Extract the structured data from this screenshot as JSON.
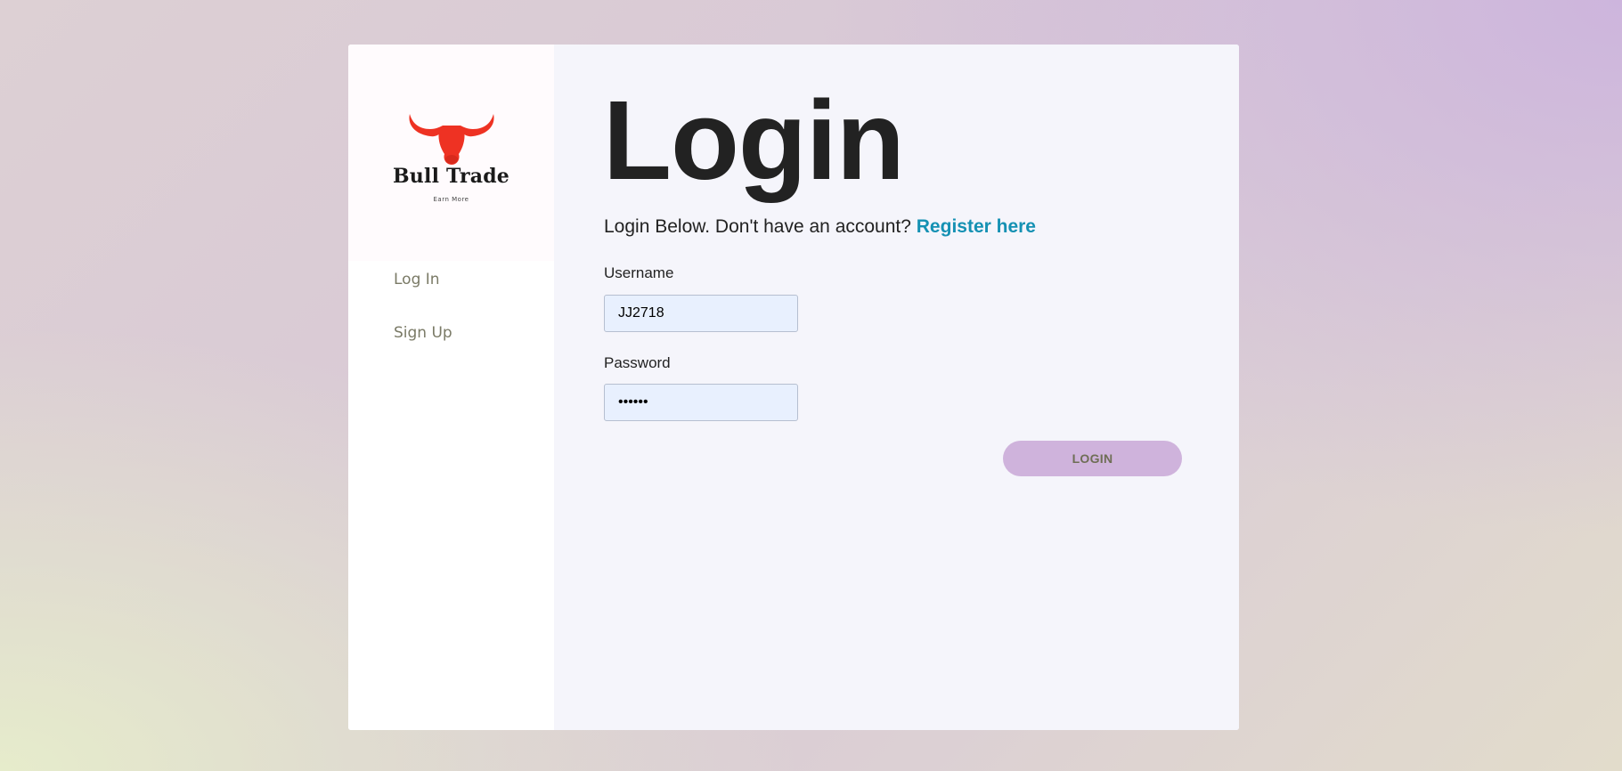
{
  "brand": {
    "name": "Bull Trade",
    "tagline": "Earn More",
    "logo_icon": "bull-head-icon",
    "logo_color": "#ee3223"
  },
  "sidebar": {
    "items": [
      {
        "label": "Log In"
      },
      {
        "label": "Sign Up"
      }
    ]
  },
  "main": {
    "title": "Login",
    "subtitle_text": "Login Below. Don't have an account?",
    "register_link": "Register here",
    "username_label": "Username",
    "username_value": "JJ2718",
    "password_label": "Password",
    "password_value": "••••••",
    "login_button": "LOGIN"
  },
  "colors": {
    "link": "#1591b3",
    "button_bg": "#cfb3dc",
    "input_bg": "#e8f0fe"
  }
}
